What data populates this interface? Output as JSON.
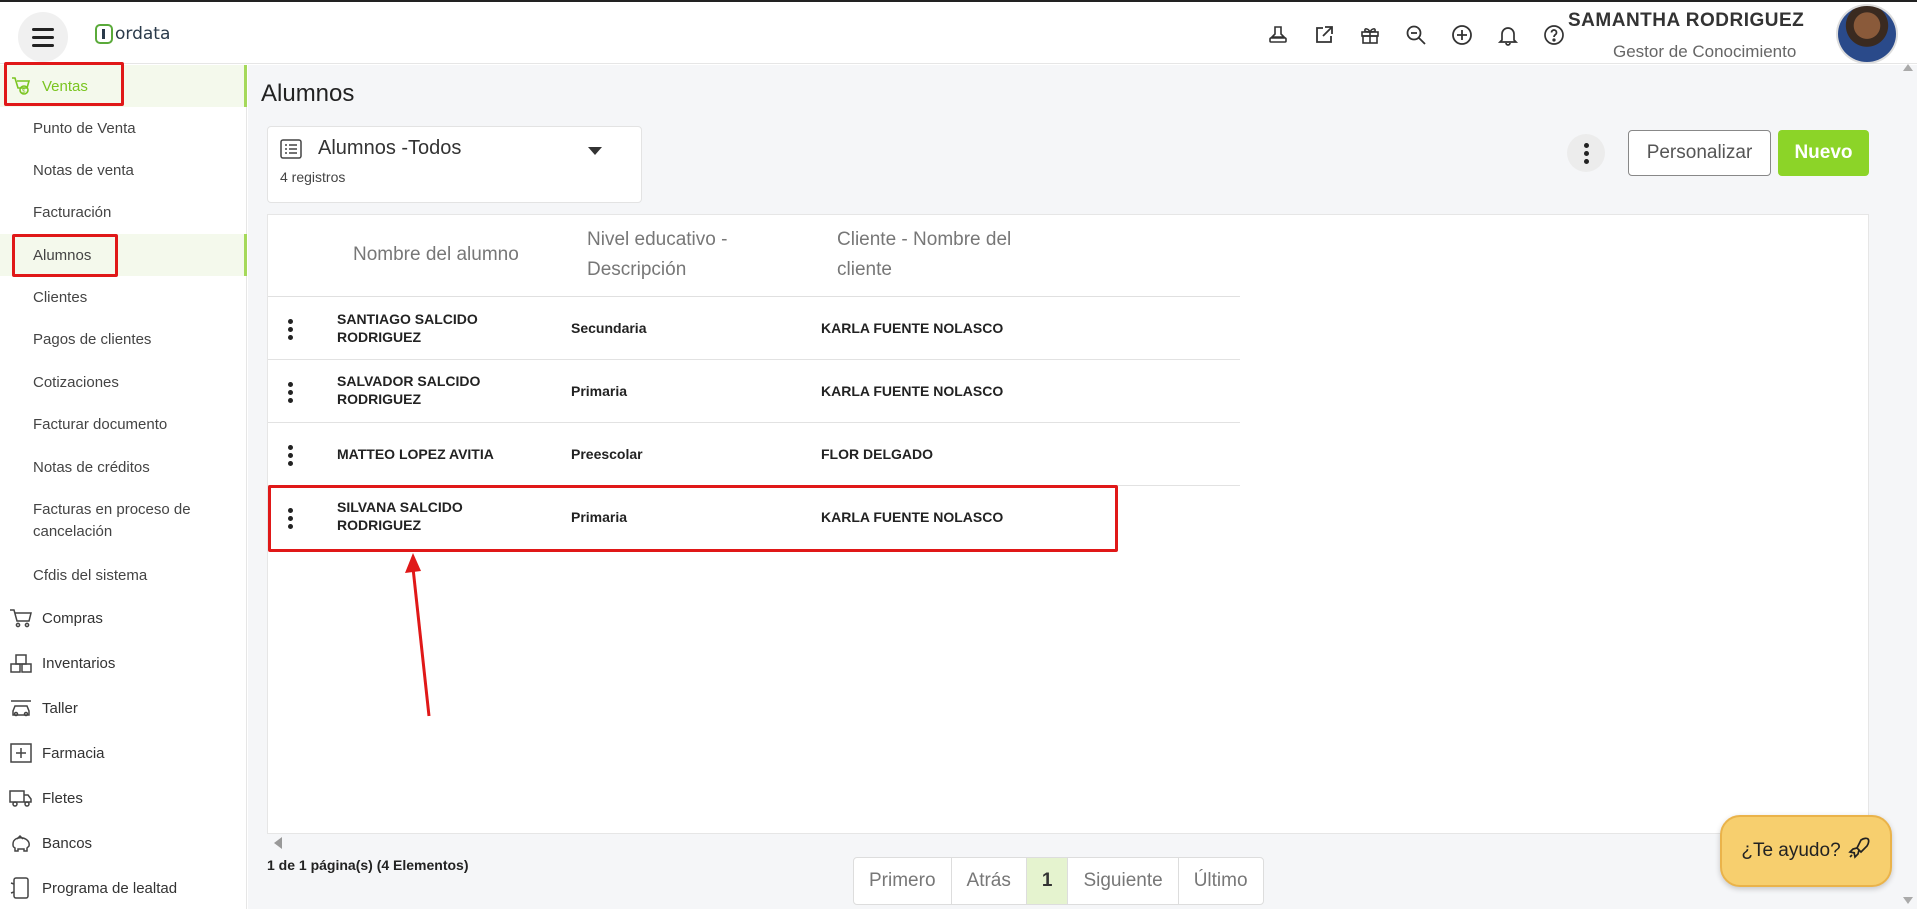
{
  "header": {
    "logo_text": "ordata",
    "icons": [
      "stamp-icon",
      "external-link-icon",
      "gift-icon",
      "search-zoom-icon",
      "plus-circle-icon",
      "bell-icon",
      "help-circle-icon"
    ],
    "user_name": "SAMANTHA RODRIGUEZ",
    "user_role": "Gestor de Conocimiento"
  },
  "sidebar": {
    "section_ventas": "Ventas",
    "ventas_items": [
      "Punto de Venta",
      "Notas de venta",
      "Facturación",
      "Alumnos",
      "Clientes",
      "Pagos de clientes",
      "Cotizaciones",
      "Facturar documento",
      "Notas de créditos",
      "Facturas en proceso de cancelación",
      "Cfdis del sistema"
    ],
    "sections": [
      "Compras",
      "Inventarios",
      "Taller",
      "Farmacia",
      "Fletes",
      "Bancos",
      "Programa de lealtad"
    ]
  },
  "main": {
    "title": "Alumnos",
    "view": {
      "name": "Alumnos -Todos",
      "count": "4 registros"
    },
    "buttons": {
      "personalizar": "Personalizar",
      "nuevo": "Nuevo"
    },
    "columns": [
      "Nombre del alumno",
      "Nivel educativo - Descripción",
      "Cliente - Nombre del cliente"
    ],
    "rows": [
      {
        "nombre": "SANTIAGO SALCIDO RODRIGUEZ",
        "nivel": "Secundaria",
        "cliente": "KARLA FUENTE NOLASCO"
      },
      {
        "nombre": "SALVADOR SALCIDO RODRIGUEZ",
        "nivel": "Primaria",
        "cliente": "KARLA FUENTE NOLASCO"
      },
      {
        "nombre": "MATTEO LOPEZ AVITIA",
        "nivel": "Preescolar",
        "cliente": "FLOR DELGADO"
      },
      {
        "nombre": "SILVANA SALCIDO RODRIGUEZ",
        "nivel": "Primaria",
        "cliente": "KARLA FUENTE NOLASCO"
      }
    ],
    "pager_info": "1 de 1 página(s) (4 Elementos)",
    "pager": {
      "first": "Primero",
      "prev": "Atrás",
      "current": "1",
      "next": "Siguiente",
      "last": "Último"
    }
  },
  "help_button": "¿Te ayudo?",
  "colors": {
    "accent": "#8cd428",
    "annotation": "#e01818",
    "help_bg": "#f7cf6e"
  }
}
